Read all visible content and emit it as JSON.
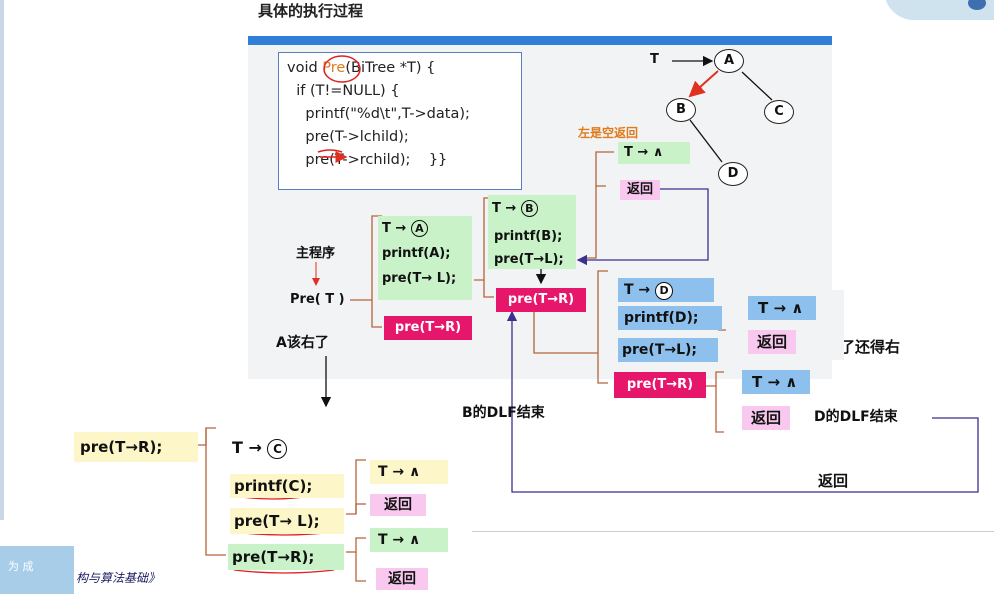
{
  "title": "具体的执行过程",
  "code": {
    "line1_pre": "void ",
    "line1_name": "Pre",
    "line1_post": "(BiTree *T) {",
    "line2": "  if (T!=NULL) {",
    "line3": "    printf(\"%d\\t\",T->data);",
    "line4": "    pre(T->lchild);",
    "line5": "    pre(T->rchild);    }}"
  },
  "tree": {
    "t_label": "T",
    "nodes": [
      "A",
      "B",
      "C",
      "D"
    ],
    "left_empty_note": "左是空返回"
  },
  "main": {
    "main_label": "主程序",
    "pre_t": "Pre( T )",
    "a_note": "A该右了"
  },
  "frameA": {
    "t": "T",
    "node": "A",
    "printf": "printf(A);",
    "pre_l": "pre(T→ L);",
    "pre_r": "pre(T→R)"
  },
  "frameB": {
    "t": "T",
    "node": "B",
    "printf": "printf(B);",
    "pre_l": "pre(T→L);",
    "pre_r": "pre(T→R)",
    "end": "B的DLF结束"
  },
  "frameB_left": {
    "t": "T",
    "caret": "∧",
    "ret": "返回"
  },
  "frameD": {
    "t": "T",
    "node": "D",
    "printf": "printf(D);",
    "pre_l": "pre(T→L);",
    "pre_r": "pre(T→R)",
    "end": "D的DLF结束",
    "left_done": "左完了还得右"
  },
  "frameD_left": {
    "t": "T",
    "caret": "∧",
    "ret": "返回"
  },
  "frameD_right": {
    "t": "T",
    "caret": "∧",
    "ret": "返回"
  },
  "return_label": "返回",
  "panelC": {
    "call": "pre(T→R);",
    "t": "T",
    "node": "C",
    "printf": "printf(C);",
    "pre_l": "pre(T→ L);",
    "pre_r": "pre(T→R);",
    "left_t": "T",
    "left_caret": "∧",
    "left_ret": "返回",
    "right_t": "T",
    "right_caret": "∧",
    "right_ret": "返回"
  },
  "footer": {
    "left_text": "为 成",
    "book_text": "构与算法基础》"
  },
  "colors": {
    "green": "#c9f2c9",
    "pink": "#f8c8ef",
    "blue": "#8ec0ee",
    "red": "#e6176b",
    "line_brown": "#b5653a",
    "line_purple": "#3b2f8f"
  }
}
